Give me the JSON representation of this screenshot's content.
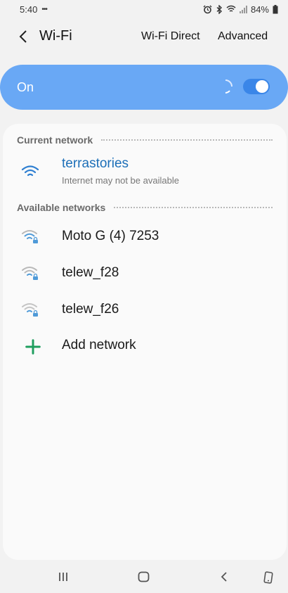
{
  "status": {
    "time": "5:40",
    "notif_dots": "•••",
    "battery": "84%"
  },
  "app_bar": {
    "title": "Wi-Fi",
    "wifi_direct": "Wi-Fi Direct",
    "advanced": "Advanced"
  },
  "toggle": {
    "label": "On",
    "checked": true
  },
  "current_network": {
    "header": "Current network",
    "ssid": "terrastories",
    "status": "Internet may not be available",
    "icon": "wifi-full-icon"
  },
  "available_networks": {
    "header": "Available networks",
    "items": [
      {
        "ssid": "Moto G (4) 7253",
        "icon": "wifi-lock-icon"
      },
      {
        "ssid": "telew_f28",
        "icon": "wifi-lock-icon"
      },
      {
        "ssid": "telew_f26",
        "icon": "wifi-lock-icon"
      }
    ]
  },
  "add_network": {
    "label": "Add network",
    "icon": "plus-icon"
  },
  "colors": {
    "accent": "#3a86e8",
    "toggle_bg": "#69a8f5",
    "current_ssid": "#1d6fb8",
    "plus": "#1e9e5e"
  }
}
